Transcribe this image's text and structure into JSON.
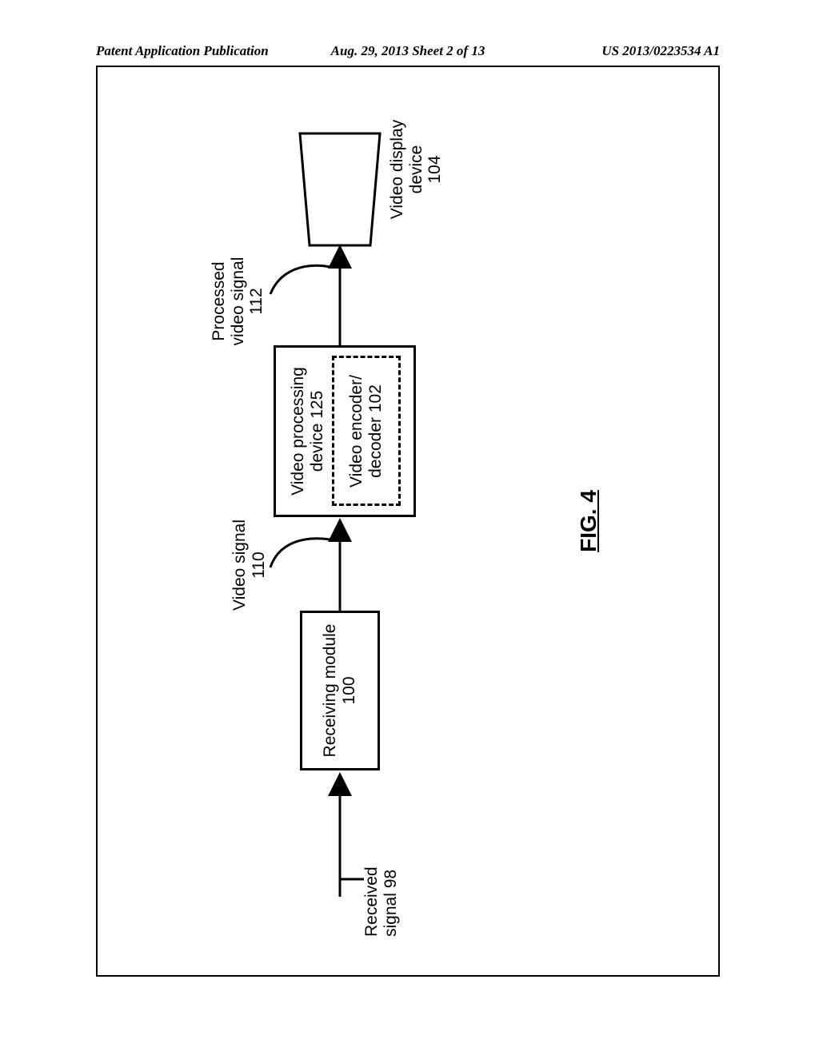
{
  "header": {
    "left": "Patent Application Publication",
    "mid": "Aug. 29, 2013  Sheet 2 of 13",
    "right": "US 2013/0223534 A1"
  },
  "figure": {
    "title": "FIG. 4",
    "received_signal_label": "Received\nsignal 98",
    "receiving_module": "Receiving module\n100",
    "video_signal_label": "Video signal\n110",
    "video_processing": "Video processing\ndevice 125",
    "encoder_decoder": "Video encoder/\ndecoder 102",
    "processed_signal_label": "Processed\nvideo signal\n112",
    "video_display": "Video display\ndevice\n104"
  }
}
